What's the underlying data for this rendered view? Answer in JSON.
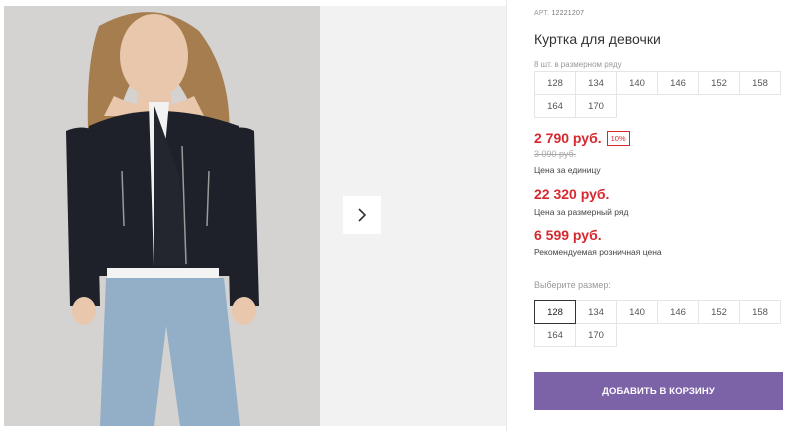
{
  "product": {
    "article_label": "АРТ.",
    "article": "12221207",
    "title": "Куртка для девочки",
    "pack_note": "8 шт. в размерном ряду",
    "pack_sizes": [
      "128",
      "134",
      "140",
      "146",
      "152",
      "158",
      "164",
      "170"
    ],
    "price": "2 790 руб.",
    "discount": "10%",
    "old_price": "3 090 руб.",
    "price_unit_label": "Цена за единицу",
    "row_price": "22 320 руб.",
    "row_price_label": "Цена за размерный ряд",
    "retail_price": "6 599 руб.",
    "retail_price_label": "Рекомендуемая розничная цена",
    "choose_size_label": "Выберите размер:",
    "sizes": [
      "128",
      "134",
      "140",
      "146",
      "152",
      "158",
      "164",
      "170"
    ],
    "selected_size": "128",
    "add_to_cart_label": "ДОБАВИТЬ В КОРЗИНУ"
  },
  "colors": {
    "price_red": "#d7282f",
    "button_purple": "#7c63a8"
  },
  "icons": {
    "next": "chevron-right-icon"
  }
}
